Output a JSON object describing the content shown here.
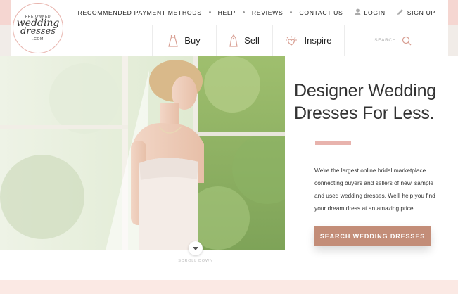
{
  "logo": {
    "pre": "PRE OWNED",
    "line1": "wedding",
    "line2": "dresses",
    "suffix": ".COM"
  },
  "topbar": {
    "links": [
      {
        "label": "RECOMMENDED PAYMENT METHODS"
      },
      {
        "label": "HELP"
      },
      {
        "label": "REVIEWS"
      },
      {
        "label": "CONTACT US"
      }
    ],
    "login_label": "LOGIN",
    "signup_label": "SIGN UP"
  },
  "nav": {
    "buy": "Buy",
    "sell": "Sell",
    "inspire": "Inspire",
    "search_placeholder": "SEARCH"
  },
  "hero": {
    "headline_line1": "Designer Wedding",
    "headline_line2": "Dresses For Less.",
    "blurb": "We're the largest online bridal marketplace connecting buyers and sellers of new, sample and used wedding dresses. We'll help you find your dream dress at an amazing price.",
    "cta_label": "SEARCH WEDDING DRESSES",
    "scroll_label": "SCROLL DOWN"
  },
  "colors": {
    "accent": "#e8b3ad",
    "cta": "#c38d78",
    "text": "#333333"
  }
}
